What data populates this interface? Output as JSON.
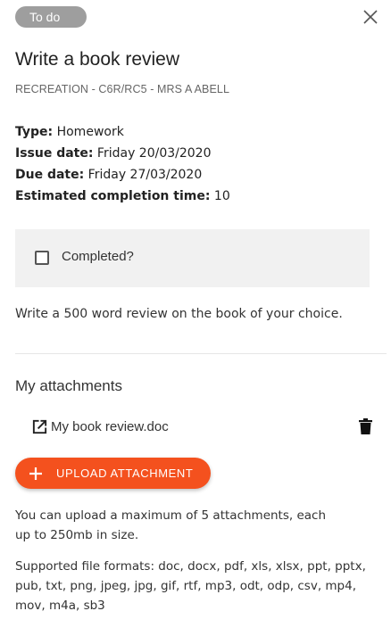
{
  "status": "To do",
  "title": "Write a book review",
  "subtitle": "RECREATION - C6R/RC5 - MRS A ABELL",
  "meta": {
    "type_label": "Type:",
    "type_value": "Homework",
    "issue_label": "Issue date:",
    "issue_value": "Friday 20/03/2020",
    "due_label": "Due date:",
    "due_value": "Friday 27/03/2020",
    "estimate_label": "Estimated completion time:",
    "estimate_value": "10"
  },
  "completed_label": "Completed?",
  "completed_checked": false,
  "description": "Write a 500 word review on the book of your choice.",
  "attachments": {
    "title": "My attachments",
    "items": [
      {
        "name": "My book review.doc",
        "icon": "open-in-new-icon",
        "action_icon": "trash-icon"
      }
    ],
    "upload_label": "UPLOAD ATTACHMENT",
    "upload_color": "#f4511e",
    "limit_note": "You can upload a maximum of 5 attachments, each up to 250mb in size.",
    "formats_note": "Supported file formats: doc, docx, pdf, xls, xlsx, ppt, pptx, pub, txt, png, jpeg, jpg, gif, rtf, mp3, odt, odp, csv, mp4, mov, m4a, sb3"
  }
}
